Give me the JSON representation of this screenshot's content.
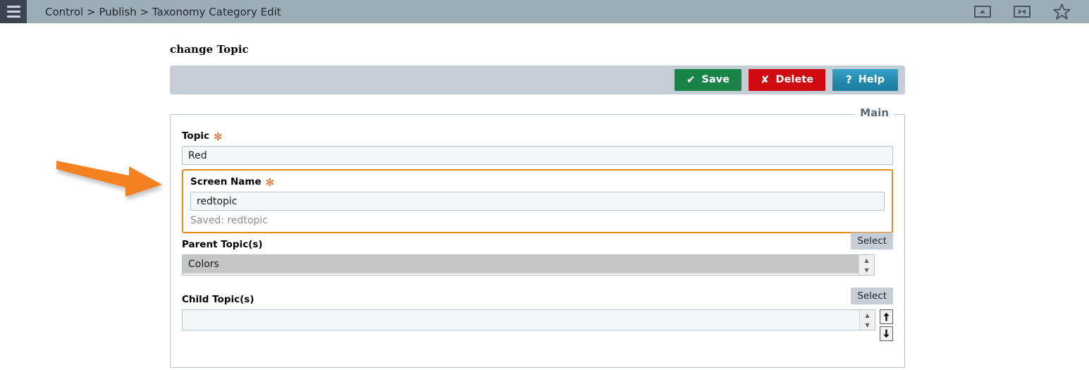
{
  "header": {
    "menu_icon": "hamburger-menu-icon",
    "breadcrumb": "Control > Publish > Taxonomy Category Edit",
    "icons": [
      {
        "name": "collapse-header-icon",
        "title": "Collapse header"
      },
      {
        "name": "collapse-width-icon",
        "title": "Fit width"
      },
      {
        "name": "favorite-star-icon",
        "title": "Favorite"
      }
    ],
    "bar_color": "#9cadb8",
    "menu_button_color": "#3b4450"
  },
  "page": {
    "title": "change Topic"
  },
  "toolbar": {
    "save_label": "Save",
    "save_glyph": "✔",
    "save_color": "#1a8348",
    "delete_label": "Delete",
    "delete_glyph": "✘",
    "delete_color": "#cf0a10",
    "help_label": "Help",
    "help_glyph": "?",
    "help_color": "#2388ae",
    "background": "#c5ced6"
  },
  "fieldset": {
    "legend": "Main",
    "border_color": "#b4c4cc",
    "legend_color": "#5a6b7d"
  },
  "fields": {
    "topic": {
      "label": "Topic",
      "required_marker": "✻",
      "value": "Red",
      "placeholder": ""
    },
    "screen_name": {
      "label": "Screen Name",
      "required_marker": "✻",
      "value": "redtopic",
      "placeholder": "",
      "saved_text": "Saved: redtopic",
      "highlight_color": "#e8871c"
    },
    "parent_topics": {
      "label": "Parent Topic(s)",
      "select_button": "Select",
      "options": [
        "Colors"
      ],
      "selected": "Colors"
    },
    "child_topics": {
      "label": "Child Topic(s)",
      "select_button": "Select",
      "options": [],
      "move_up_glyph": "⬆",
      "move_down_glyph": "⬇"
    }
  },
  "annotation": {
    "name": "orange-pointer-arrow",
    "color": "#f58220",
    "points_to": "screen-name-field"
  }
}
